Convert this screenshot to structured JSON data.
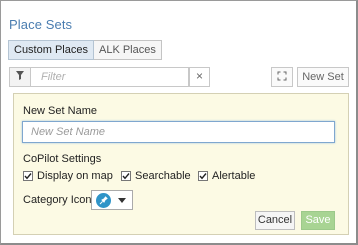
{
  "panel": {
    "title": "Place Sets",
    "tabs": [
      {
        "label": "Custom Places",
        "active": true
      },
      {
        "label": "ALK Places",
        "active": false
      }
    ]
  },
  "toolbar": {
    "filter_icon": "filter-funnel-icon",
    "filter_placeholder": "Filter",
    "filter_value": "",
    "clear_label": "×",
    "expand_icon": "expand-icon",
    "new_set_label": "New Set"
  },
  "form": {
    "name_label": "New Set Name",
    "name_placeholder": "New Set Name",
    "name_value": "",
    "copilot_label": "CoPilot Settings",
    "options": [
      {
        "label": "Display on map",
        "checked": true
      },
      {
        "label": "Searchable",
        "checked": true
      },
      {
        "label": "Alertable",
        "checked": true
      }
    ],
    "category_icon_label": "Category Icon",
    "category_icon": "map-pin-icon",
    "cancel_label": "Cancel",
    "save_label": "Save"
  },
  "colors": {
    "title": "#4a7db0",
    "form_bg": "#fcfae4",
    "save_bg": "#a8d493",
    "icon_bg": "#2f94c8"
  }
}
